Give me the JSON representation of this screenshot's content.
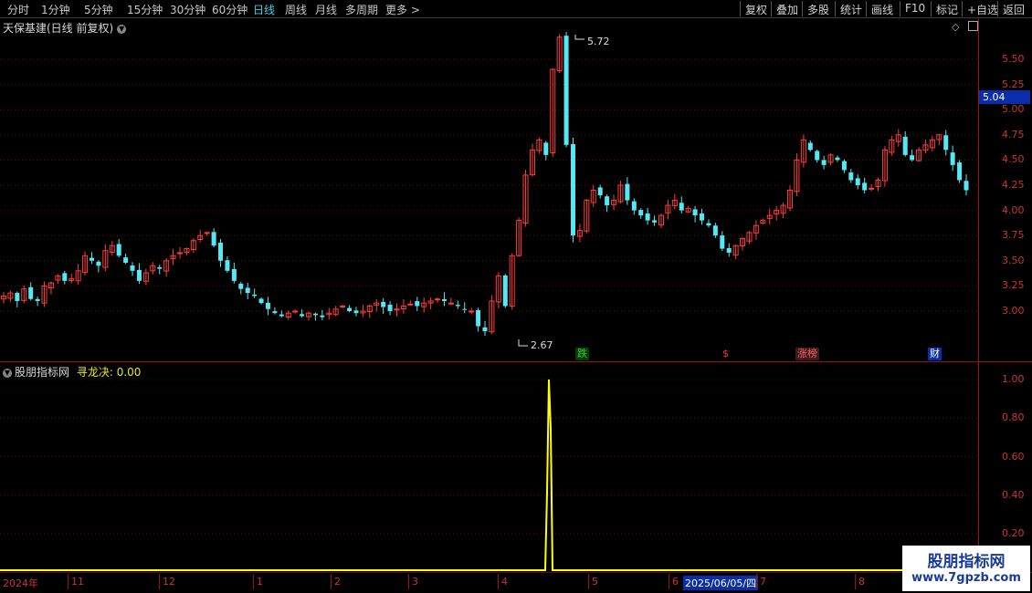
{
  "toolbar": {
    "periods": [
      "分时",
      "1分钟",
      "5分钟",
      "15分钟",
      "30分钟",
      "60分钟",
      "日线",
      "周线",
      "月线",
      "多周期",
      "更多 >"
    ],
    "active_period": "日线",
    "buttons": [
      "复权",
      "叠加",
      "多股",
      "统计",
      "画线",
      "F10",
      "标记",
      "+自选",
      "返回"
    ]
  },
  "main": {
    "title": "天保基建(日线 前复权)",
    "current_price": "5.04",
    "high_label": "5.72",
    "low_label": "2.67",
    "y_ticks": [
      "5.50",
      "5.25",
      "5.00",
      "4.75",
      "4.50",
      "4.25",
      "4.00",
      "3.75",
      "3.50",
      "3.25",
      "3.00"
    ],
    "markers": [
      {
        "text": "跌",
        "color": "#2fd02f",
        "bg": "#0a3a0a"
      },
      {
        "text": "$",
        "color": "#ff3030",
        "bg": "#000000"
      },
      {
        "text": "涨榜",
        "color": "#ff6060",
        "bg": "#3a1a1a"
      },
      {
        "text": "财",
        "color": "#ffffff",
        "bg": "#0a2eab"
      }
    ]
  },
  "indicator": {
    "name": "股朋指标网",
    "label": "寻龙决: 0.00",
    "y_ticks": [
      "1.00",
      "0.80",
      "0.60",
      "0.40",
      "0.20"
    ]
  },
  "xaxis": {
    "labels": [
      "2024年",
      "11",
      "12",
      "1",
      "2",
      "3",
      "4",
      "5",
      "6",
      "2025/06/05/四",
      "7",
      "8"
    ],
    "selected": "2025/06/05/四"
  },
  "watermark": {
    "line1": "股朋指标网",
    "line2": "www.7gpzb.com"
  },
  "chart_data": {
    "type": "candlestick",
    "series": [
      {
        "values": [
          3.15,
          3.18,
          3.1,
          3.22,
          3.12,
          3.1,
          3.25,
          3.28,
          3.35,
          3.3,
          3.32,
          3.4,
          3.55,
          3.5,
          3.45,
          3.6,
          3.65,
          3.55,
          3.48,
          3.4,
          3.3,
          3.38,
          3.45,
          3.42,
          3.5,
          3.55,
          3.58,
          3.62,
          3.7,
          3.75,
          3.78,
          3.65,
          3.5,
          3.4,
          3.3,
          3.22,
          3.18,
          3.15,
          3.08,
          3.02,
          2.98,
          2.95,
          2.98,
          3.0,
          2.95,
          2.98,
          2.96,
          2.94,
          2.98,
          3.02,
          3.05,
          3.0,
          2.98,
          3.0,
          3.05,
          3.08,
          3.04,
          3.0,
          3.02,
          3.05,
          3.07,
          3.05,
          3.08,
          3.1,
          3.12,
          3.1,
          3.08,
          3.05,
          3.02,
          3.0,
          2.85,
          2.8,
          3.1,
          3.35,
          3.05,
          3.55,
          3.9,
          4.35,
          4.6,
          4.7,
          4.55,
          5.4,
          5.72,
          4.65,
          3.75,
          3.8,
          4.1,
          4.2,
          4.15,
          4.05,
          4.1,
          4.25,
          4.1,
          4.0,
          3.95,
          3.9,
          3.88,
          3.95,
          4.05,
          4.1,
          4.0,
          4.02,
          3.95,
          3.9,
          3.85,
          3.75,
          3.62,
          3.58,
          3.65,
          3.72,
          3.78,
          3.85,
          3.9,
          3.95,
          4.0,
          4.05,
          4.2,
          4.5,
          4.7,
          4.6,
          4.5,
          4.45,
          4.55,
          4.5,
          4.4,
          4.3,
          4.25,
          4.2,
          4.22,
          4.3,
          4.6,
          4.7,
          4.75,
          4.55,
          4.5,
          4.6,
          4.65,
          4.7,
          4.75,
          4.6,
          4.45,
          4.3,
          4.2
        ]
      },
      {
        "name": "寻龙决",
        "values": [
          0,
          0,
          0,
          0,
          0,
          0,
          0,
          0,
          0,
          0,
          1,
          0,
          0,
          0,
          0,
          0,
          0,
          0,
          0,
          0
        ]
      }
    ]
  }
}
